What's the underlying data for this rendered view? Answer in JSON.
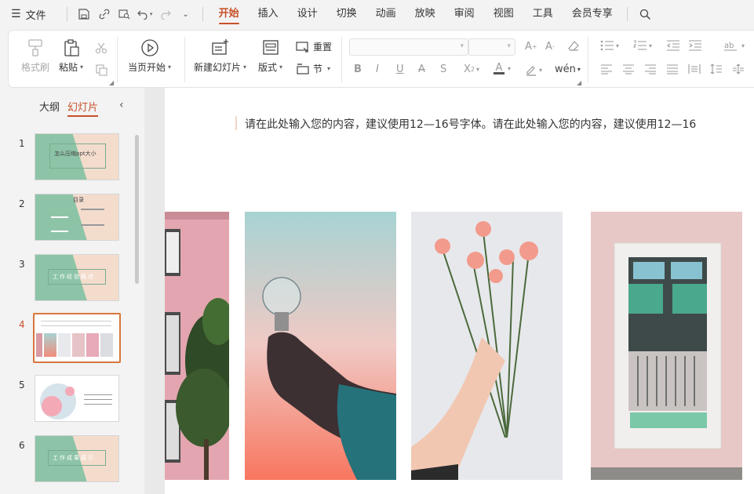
{
  "menubar": {
    "file_label": "文件",
    "tabs": [
      "开始",
      "插入",
      "设计",
      "切换",
      "动画",
      "放映",
      "审阅",
      "视图",
      "工具",
      "会员专享"
    ],
    "active_tab": "开始"
  },
  "ribbon": {
    "format_painter": "格式刷",
    "paste": "粘贴",
    "from_current": "当页开始",
    "new_slide": "新建幻灯片",
    "layout": "版式",
    "reset": "重置",
    "section": "节"
  },
  "panel": {
    "tab_outline": "大纲",
    "tab_slides": "幻灯片",
    "active_tab": "幻灯片",
    "thumbnails": [
      {
        "num": "1",
        "text": "怎么压缩ppt大小"
      },
      {
        "num": "2",
        "text": "目录"
      },
      {
        "num": "3",
        "text": "工作经验概述"
      },
      {
        "num": "4",
        "text": ""
      },
      {
        "num": "5",
        "text": ""
      },
      {
        "num": "6",
        "text": "工作成果展示"
      }
    ],
    "active_index": 4
  },
  "slide": {
    "text": "请在此处输入您的内容，建议使用12—16号字体。请在此处输入您的内容，建议使用12—16"
  },
  "colors": {
    "accent": "#c7512a",
    "thumb_green": "#8dc4a7",
    "thumb_peach": "#f4dccd"
  }
}
